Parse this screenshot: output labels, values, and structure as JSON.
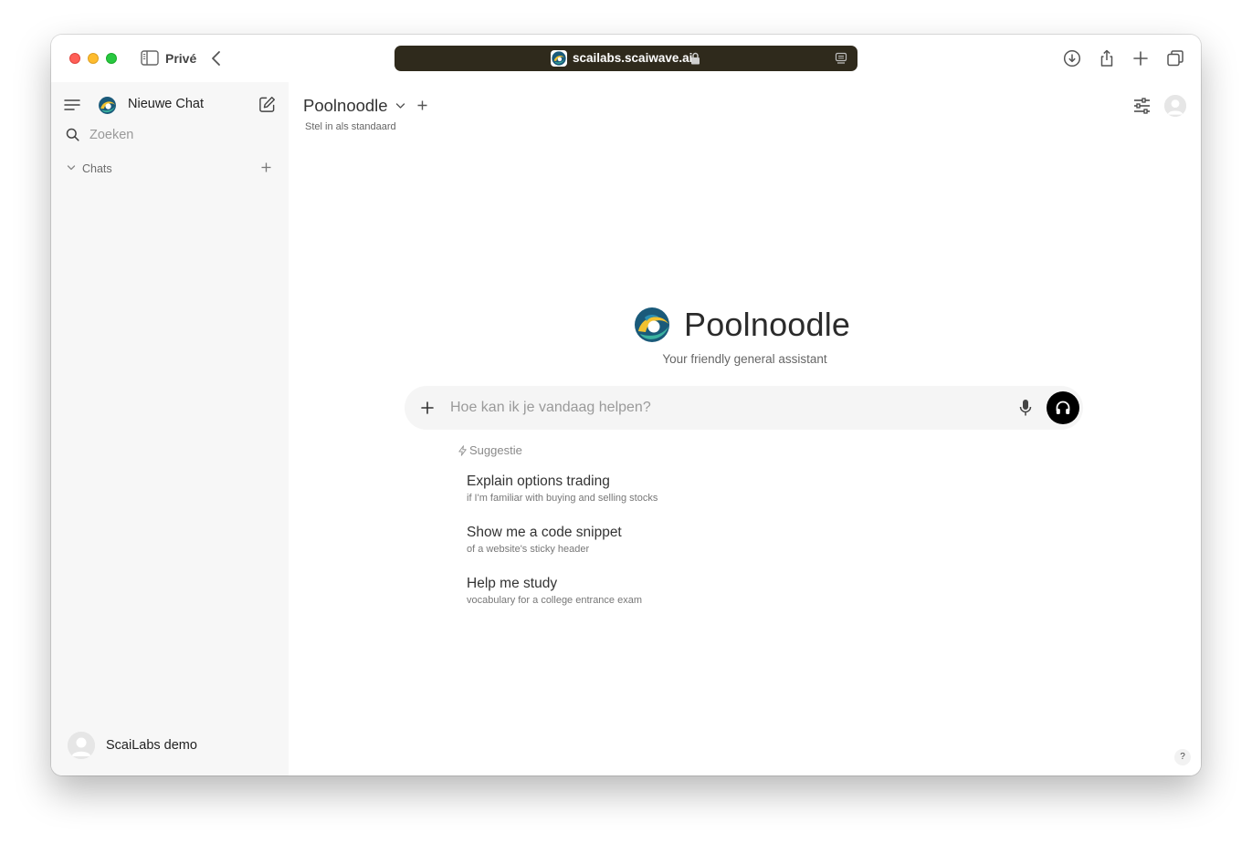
{
  "browser": {
    "private_label": "Privé",
    "url": "scailabs.scaiwave.ai"
  },
  "sidebar": {
    "new_chat_label": "Nieuwe Chat",
    "search_placeholder": "Zoeken",
    "chats_section_label": "Chats",
    "user_name": "ScaiLabs demo"
  },
  "header": {
    "model_name": "Poolnoodle",
    "set_default_label": "Stel in als standaard"
  },
  "hero": {
    "title": "Poolnoodle",
    "subtitle": "Your friendly general assistant"
  },
  "prompt": {
    "placeholder": "Hoe kan ik je vandaag helpen?"
  },
  "suggestions": {
    "heading": "Suggestie",
    "items": [
      {
        "title": "Explain options trading",
        "subtitle": "if I'm familiar with buying and selling stocks"
      },
      {
        "title": "Show me a code snippet",
        "subtitle": "of a website's sticky header"
      },
      {
        "title": "Help me study",
        "subtitle": "vocabulary for a college entrance exam"
      }
    ]
  },
  "help_label": "?",
  "icons": {
    "sidebar_toggle": "sidebar-icon",
    "back": "chevron-left-icon",
    "lock": "lock-icon",
    "download": "download-icon",
    "share": "share-icon",
    "new_tab": "plus-icon",
    "tabs": "tabs-overview-icon",
    "menu": "menu-icon",
    "edit": "edit-icon",
    "search": "search-icon",
    "sliders": "sliders-icon",
    "mic": "microphone-icon",
    "voice": "headphones-icon"
  },
  "colors": {
    "urlbar_bg": "#2f2a1c",
    "sidebar_bg": "#f7f7f7",
    "prompt_bg": "#f5f5f5",
    "voice_button_bg": "#000000"
  }
}
